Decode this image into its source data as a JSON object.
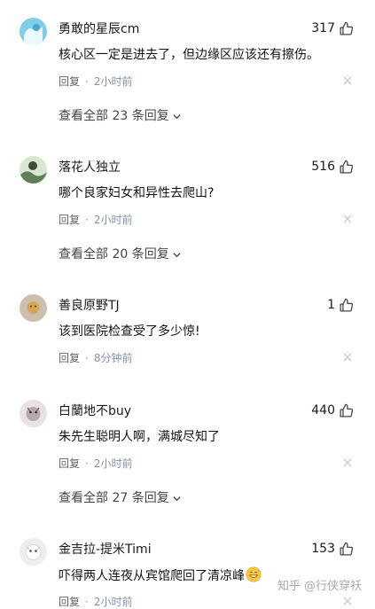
{
  "comments": [
    {
      "username": "勇敢的星辰cm",
      "likes": "317",
      "text": "核心区一定是进去了，但边缘区应该还有擦伤。",
      "reply_label": "回复",
      "time": "2小时前",
      "view_all": "查看全部 23 条回复"
    },
    {
      "username": "落花人独立",
      "likes": "516",
      "text": "哪个良家妇女和异性去爬山?",
      "reply_label": "回复",
      "time": "2小时前",
      "view_all": "查看全部 20 条回复"
    },
    {
      "username": "善良原野TJ",
      "likes": "1",
      "text": "该到医院检查受了多少惊!",
      "reply_label": "回复",
      "time": "8分钟前"
    },
    {
      "username": "白蘭地不buy",
      "likes": "440",
      "text": "朱先生聪明人啊，满城尽知了",
      "reply_label": "回复",
      "time": "2小时前",
      "view_all": "查看全部 27 条回复"
    },
    {
      "username": "金吉拉-提米Timi",
      "likes": "153",
      "text": "吓得两人连夜从宾馆爬回了清凉峰",
      "reply_label": "回复",
      "time": "2小时前"
    }
  ],
  "watermark": "知乎 @行侠穿袄",
  "colors": {
    "meta": "#8590a6",
    "text": "#121212",
    "reply": "#646464"
  },
  "icons": {
    "like": "thumb-up-icon",
    "close": "close-icon",
    "expand": "chevron-down-icon",
    "emoji": "grin-sweat-emoji"
  }
}
